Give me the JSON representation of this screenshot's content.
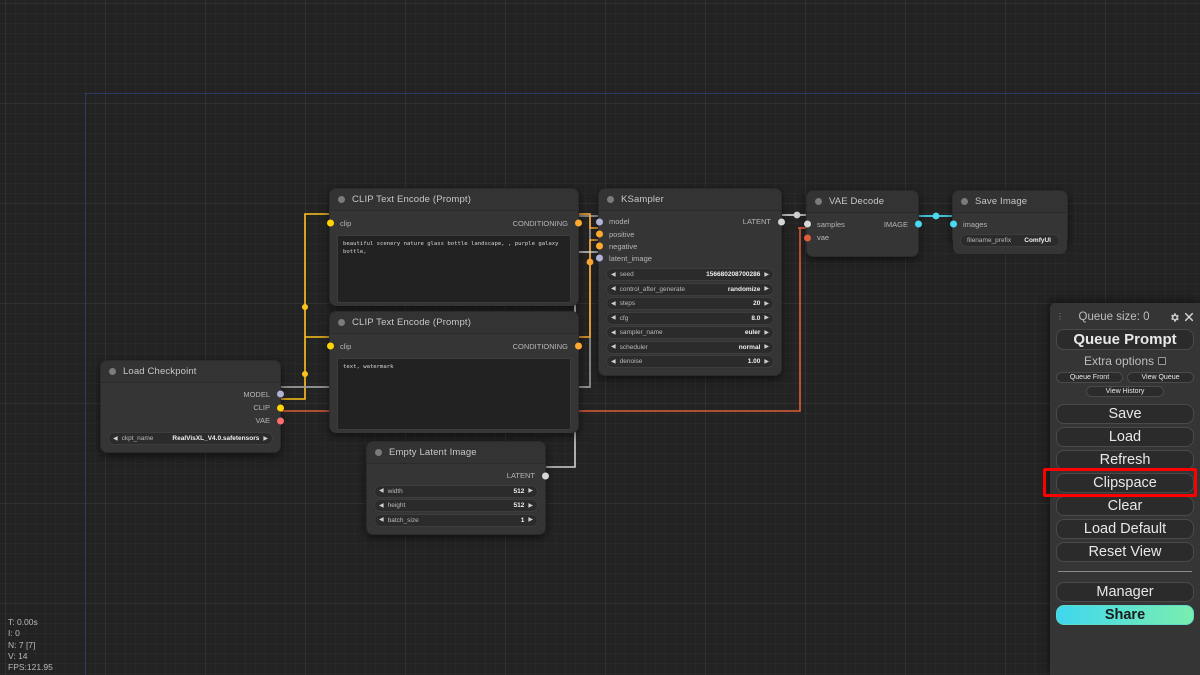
{
  "app": {
    "name": "ComfyUI"
  },
  "canvas": {
    "stats": {
      "time": "T: 0.00s",
      "iterations": "I: 0",
      "nodes": "N: 7 [7]",
      "vertices": "V: 14",
      "fps": "FPS:121.95"
    }
  },
  "nodes": {
    "load_checkpoint": {
      "title": "Load Checkpoint",
      "outputs": [
        {
          "label": "MODEL",
          "color": "#b0b3d6"
        },
        {
          "label": "CLIP",
          "color": "#ffd500"
        },
        {
          "label": "VAE",
          "color": "#ff6e6e"
        }
      ],
      "widgets": [
        {
          "name": "ckpt_name",
          "value": "RealVisXL_V4.0.safetensors"
        }
      ]
    },
    "clip_positive": {
      "title": "CLIP Text Encode (Prompt)",
      "input": {
        "label": "clip",
        "color": "#ffd500"
      },
      "output": {
        "label": "CONDITIONING",
        "color": "#ffa931"
      },
      "text": "beautiful scenery nature glass bottle landscape, , purple galaxy bottle,"
    },
    "clip_negative": {
      "title": "CLIP Text Encode (Prompt)",
      "input": {
        "label": "clip",
        "color": "#ffd500"
      },
      "output": {
        "label": "CONDITIONING",
        "color": "#ffa931"
      },
      "text": "text, watermark"
    },
    "empty_latent": {
      "title": "Empty Latent Image",
      "output": {
        "label": "LATENT",
        "color": "#ff64c8"
      },
      "widgets": [
        {
          "name": "width",
          "value": "512"
        },
        {
          "name": "height",
          "value": "512"
        },
        {
          "name": "batch_size",
          "value": "1"
        }
      ]
    },
    "ksampler": {
      "title": "KSampler",
      "inputs": [
        {
          "label": "model",
          "color": "#b0b3d6"
        },
        {
          "label": "positive",
          "color": "#ffa931"
        },
        {
          "label": "negative",
          "color": "#ffa931"
        },
        {
          "label": "latent_image",
          "color": "#b0b3d6"
        }
      ],
      "output": {
        "label": "LATENT",
        "color": "#b0b3d6"
      },
      "widgets": [
        {
          "name": "seed",
          "value": "156680208700286"
        },
        {
          "name": "control_after_generate",
          "value": "randomize"
        },
        {
          "name": "steps",
          "value": "20"
        },
        {
          "name": "cfg",
          "value": "8.0"
        },
        {
          "name": "sampler_name",
          "value": "euler"
        },
        {
          "name": "scheduler",
          "value": "normal"
        },
        {
          "name": "denoise",
          "value": "1.00"
        }
      ]
    },
    "vae_decode": {
      "title": "VAE Decode",
      "inputs": [
        {
          "label": "samples",
          "color": "#b0b3d6"
        },
        {
          "label": "vae",
          "color": "#ff6e6e"
        }
      ],
      "output": {
        "label": "IMAGE",
        "color": "#64e8ff"
      }
    },
    "save_image": {
      "title": "Save Image",
      "input": {
        "label": "images",
        "color": "#64e8ff"
      },
      "widgets": [
        {
          "name": "filename_prefix",
          "value": "ComfyUI"
        }
      ]
    }
  },
  "menu": {
    "queue_size_label": "Queue size: 0",
    "queue_prompt": "Queue Prompt",
    "extra_options": "Extra options",
    "queue_front": "Queue Front",
    "view_queue": "View Queue",
    "view_history": "View History",
    "save": "Save",
    "load": "Load",
    "refresh": "Refresh",
    "clipspace": "Clipspace",
    "clear": "Clear",
    "load_default": "Load Default",
    "reset_view": "Reset View",
    "manager": "Manager",
    "share": "Share"
  },
  "highlight": {
    "color": "#ff0000",
    "target": "Refresh"
  }
}
